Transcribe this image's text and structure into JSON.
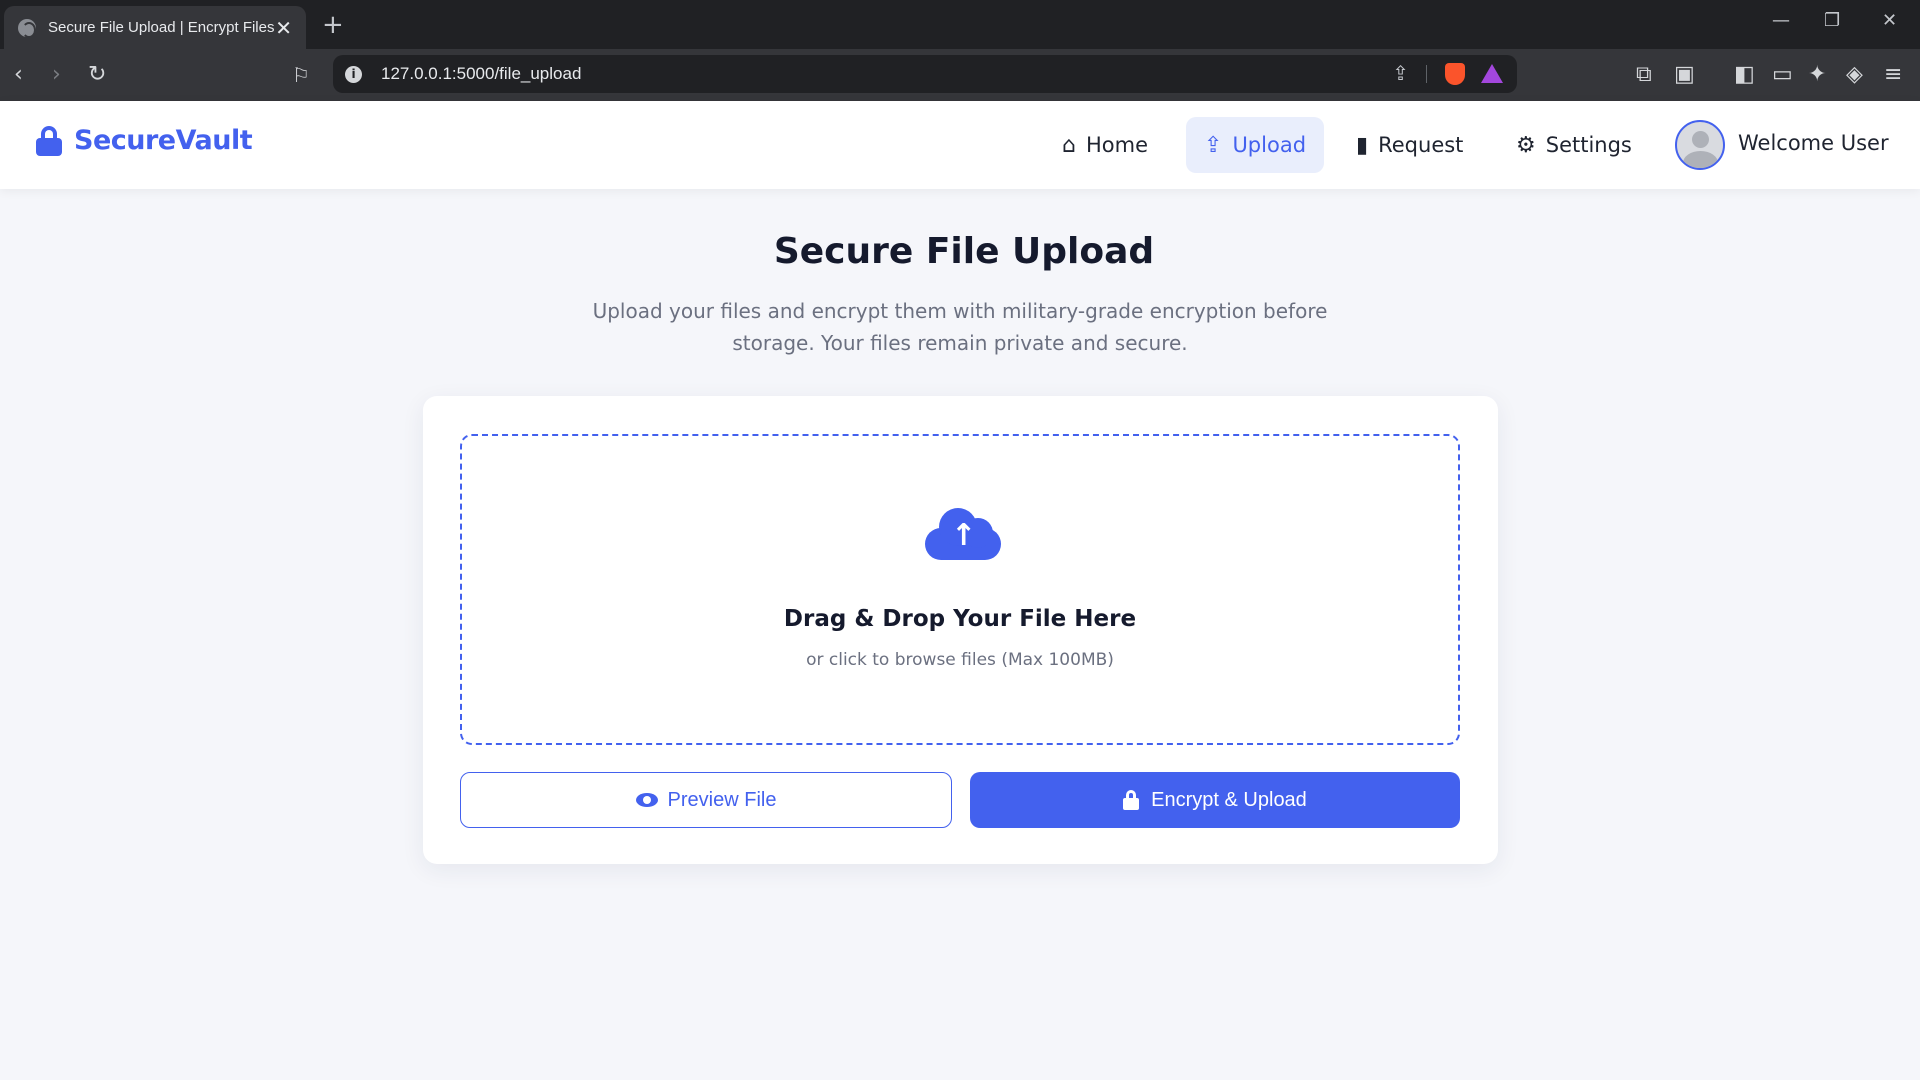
{
  "browser": {
    "tab_title": "Secure File Upload | Encrypt Files",
    "tab_close": "✕",
    "new_tab": "+",
    "url": "127.0.0.1:5000/file_upload",
    "window_minimize": "—",
    "window_restore": "❐",
    "window_close": "✕"
  },
  "nav": {
    "brand": "SecureVault",
    "items": [
      {
        "label": "Home",
        "icon": "home-icon"
      },
      {
        "label": "Upload",
        "icon": "upload-icon",
        "active": true
      },
      {
        "label": "Request",
        "icon": "file-request-icon"
      },
      {
        "label": "Settings",
        "icon": "gear-icon"
      }
    ],
    "user_label": "Welcome User"
  },
  "page": {
    "title": "Secure File Upload",
    "subtitle": "Upload your files and encrypt them with military-grade encryption before storage. Your files remain private and secure."
  },
  "dropzone": {
    "title": "Drag & Drop Your File Here",
    "subtitle": "or click to browse files (Max 100MB)"
  },
  "actions": {
    "preview_label": "Preview File",
    "encrypt_label": "Encrypt & Upload"
  },
  "colors": {
    "accent": "#4361ee",
    "background": "#f5f6fa"
  }
}
